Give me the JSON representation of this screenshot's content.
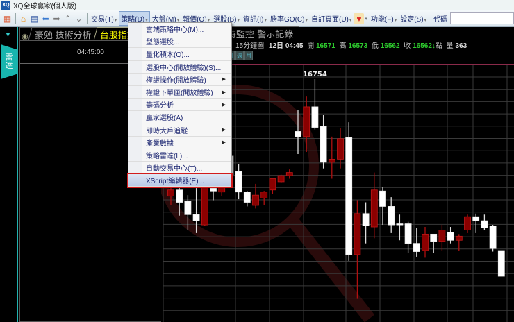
{
  "window": {
    "icon": "XQ",
    "title": "XQ全球贏家(個人版)"
  },
  "toolbar": {
    "icons": [
      "apps-grid-icon",
      "home-icon",
      "document-icon",
      "back-arrow-icon",
      "forward-arrow-icon",
      "scroll-up-icon",
      "scroll-down-icon"
    ],
    "menus": [
      "交易(T)",
      "策略(D)",
      "大盤(M)",
      "報價(Q)",
      "選股(B)",
      "資訊(I)",
      "勝率GO(C)",
      "自訂頁面(U)"
    ],
    "menus2": [
      "功能(F)",
      "設定(S)"
    ],
    "code_label": "代碼",
    "code_value": ""
  },
  "sidebar": {
    "radar_tab": [
      "雷",
      "達"
    ]
  },
  "left_panel": {
    "tabs": [
      "豪勉 技術分析",
      "台股指數"
    ],
    "time": "04:45:00"
  },
  "chart_tab": "時監控-警示記錄",
  "info": {
    "period": "15分鐘圖",
    "date": "12日",
    "time": "04:45",
    "open_label": "開",
    "open": "16571",
    "high_label": "高",
    "high": "16573",
    "low_label": "低",
    "low": "16562",
    "close_label": "收",
    "close": "16562",
    "arrow": "↓",
    "unit": "點",
    "volume_label": "量",
    "volume": "363"
  },
  "period_buttons": [
    "日",
    "週",
    "月"
  ],
  "menu": {
    "items": [
      {
        "label": "雲端策略中心(M)...",
        "submenu": false
      },
      {
        "label": "型態選股...",
        "submenu": false
      },
      {
        "label": "量化積木(Q)...",
        "submenu": false
      },
      {
        "label": "選股中心(開放體驗)(S)...",
        "submenu": false
      },
      {
        "label": "權證操作(開放體驗)",
        "submenu": true
      },
      {
        "label": "權證下單匣(開放體驗)",
        "submenu": true
      },
      {
        "label": "籌碼分析",
        "submenu": true
      },
      {
        "label": "贏家選股(A)",
        "submenu": false
      },
      {
        "label": "即時大戶追蹤",
        "submenu": true
      },
      {
        "label": "產業數據",
        "submenu": true
      },
      {
        "label": "策略雷達(L)...",
        "submenu": false
      },
      {
        "label": "自動交易中心(T)...",
        "submenu": false
      },
      {
        "label": "XScript編輯器(E)...",
        "submenu": false,
        "selected": true
      }
    ]
  },
  "colors": {
    "up": "#8b0000",
    "down": "#ffffff",
    "price_green": "#2ecc2e",
    "accent_teal": "#18b5ae",
    "highlight": "#d21c1c"
  },
  "chart_data": {
    "type": "candlestick",
    "title": "15分鐘圖",
    "max_label": "16754",
    "ylim": [
      16535,
      16770
    ],
    "candles": [
      [
        16640,
        16649,
        16631,
        16646
      ],
      [
        16646,
        16648,
        16621,
        16634
      ],
      [
        16635,
        16641,
        16607,
        16622
      ],
      [
        16622,
        16649,
        16604,
        16616
      ],
      [
        16612,
        16650,
        16611,
        16650
      ],
      [
        16650,
        16652,
        16636,
        16645
      ],
      [
        16644,
        16657,
        16640,
        16650
      ],
      [
        16679,
        16680,
        16653,
        16661
      ],
      [
        16664,
        16671,
        16637,
        16644
      ],
      [
        16644,
        16645,
        16630,
        16634
      ],
      [
        16631,
        16652,
        16628,
        16641
      ],
      [
        16638,
        16645,
        16631,
        16644
      ],
      [
        16646,
        16657,
        16642,
        16657
      ],
      [
        16654,
        16661,
        16653,
        16660
      ],
      [
        16660,
        16666,
        16657,
        16663
      ],
      [
        16703,
        16724,
        16681,
        16698
      ],
      [
        16698,
        16737,
        16683,
        16727
      ],
      [
        16727,
        16754,
        16705,
        16707
      ],
      [
        16708,
        16719,
        16667,
        16673
      ],
      [
        16673,
        16698,
        16657,
        16676
      ],
      [
        16676,
        16706,
        16667,
        16696
      ],
      [
        16697,
        16712,
        16577,
        16583
      ],
      [
        16583,
        16636,
        16540,
        16623
      ],
      [
        16623,
        16634,
        16594,
        16611
      ],
      [
        16610,
        16663,
        16599,
        16646
      ],
      [
        16645,
        16649,
        16612,
        16630
      ],
      [
        16630,
        16639,
        16604,
        16612
      ],
      [
        16613,
        16622,
        16597,
        16612
      ],
      [
        16613,
        16615,
        16585,
        16594
      ],
      [
        16594,
        16609,
        16581,
        16586
      ],
      [
        16587,
        16610,
        16580,
        16603
      ],
      [
        16603,
        16603,
        16585,
        16596
      ],
      [
        16596,
        16612,
        16587,
        16607
      ],
      [
        16605,
        16610,
        16594,
        16597
      ],
      [
        16597,
        16603,
        16587,
        16601
      ],
      [
        16607,
        16622,
        16604,
        16620
      ],
      [
        16620,
        16623,
        16604,
        16616
      ],
      [
        16616,
        16622,
        16607,
        16609
      ],
      [
        16611,
        16612,
        16586,
        16589
      ],
      [
        16587,
        16587,
        16562,
        16562
      ]
    ]
  }
}
